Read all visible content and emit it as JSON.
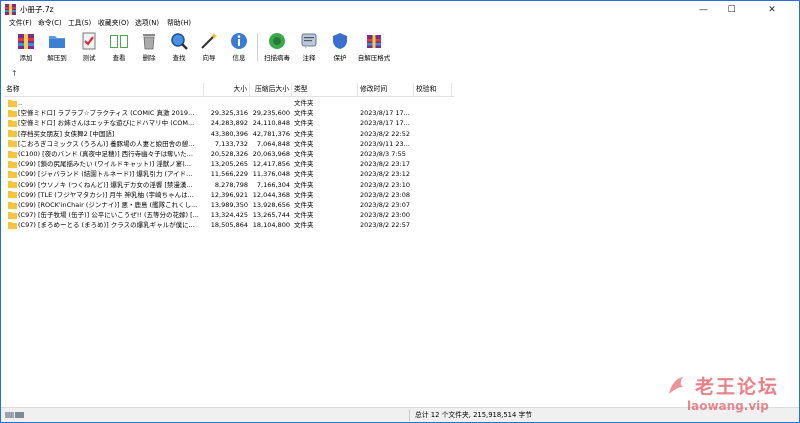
{
  "window": {
    "title": "小册子.7z"
  },
  "menu": [
    {
      "label": "文件(F)"
    },
    {
      "label": "命令(C)"
    },
    {
      "label": "工具(S)"
    },
    {
      "label": "收藏夹(O)"
    },
    {
      "label": "选项(N)"
    },
    {
      "label": "帮助(H)"
    }
  ],
  "toolbar": {
    "add": "添加",
    "extract_to": "解压到",
    "test": "测试",
    "view": "查看",
    "delete": "删除",
    "find": "查找",
    "wizard": "向导",
    "info": "信息",
    "virus_scan": "扫描病毒",
    "comment": "注释",
    "protect": "保护",
    "sfx": "自解压格式"
  },
  "nav": {
    "up_icon": "↑"
  },
  "columns": {
    "name": "名称",
    "size": "大小",
    "packed": "压缩后大小",
    "type": "类型",
    "modified": "修改时间",
    "crc": "校验和"
  },
  "rows": [
    {
      "name": "..",
      "size": "",
      "packed": "",
      "type": "文件夹",
      "modified": ""
    },
    {
      "name": "[空條ミドロ] ラブラブ☆プラクティス (COMIC 真激 2019...",
      "size": "29,325,316",
      "packed": "29,235,600",
      "type": "文件夹",
      "modified": "2023/8/17 17..."
    },
    {
      "name": "[空條ミドロ] お姉さんはエッチな遊びにドハマリ中 (COM...",
      "size": "24,283,892",
      "packed": "24,110,848",
      "type": "文件夹",
      "modified": "2023/8/17 17..."
    },
    {
      "name": "[存档买女朋友] 女侠舞2 [中国語]",
      "size": "43,380,396",
      "packed": "42,781,376",
      "type": "文件夹",
      "modified": "2023/8/2 22:52"
    },
    {
      "name": "[こおろぎコミックス (うろん)] 養豚場の人妻と娘田舎の憩...",
      "size": "7,133,732",
      "packed": "7,064,848",
      "type": "文件夹",
      "modified": "2023/9/11 23..."
    },
    {
      "name": "(C100) [夜のバンド (真夜中足穂)] 西行寺幽々子は奪いた...",
      "size": "20,528,326",
      "packed": "20,063,968",
      "type": "文件夹",
      "modified": "2023/8/3 7:55"
    },
    {
      "name": "(C99) [鎖の尻尾揺みたい (ワイルドキャット)] 淫獣ノ宴(...",
      "size": "13,205,265",
      "packed": "12,417,856",
      "type": "文件夹",
      "modified": "2023/8/2 23:17"
    },
    {
      "name": "(C99) [ジャバランド (結園トルネード)] 爆乳引力 (アイド...",
      "size": "11,566,229",
      "packed": "11,376,048",
      "type": "文件夹",
      "modified": "2023/8/2 23:12"
    },
    {
      "name": "(C99) [ウソノキ (つくねんど)] 爆乳デカ女の淫饗 [禁漫漢...",
      "size": "8,278,798",
      "packed": "7,166,304",
      "type": "文件夹",
      "modified": "2023/8/2 23:10"
    },
    {
      "name": "(C99) [TLE (フジヤマタカシ)] 月牛 神乳柚 (宇崎ちゃんは...",
      "size": "12,396,921",
      "packed": "12,044,368",
      "type": "文件夹",
      "modified": "2023/8/2 23:08"
    },
    {
      "name": "(C99) [ROCK'inChair (ジンナイ)] 悪・鹿島 (艦隊これくし...",
      "size": "13,989,350",
      "packed": "13,928,656",
      "type": "文件夹",
      "modified": "2023/8/2 23:07"
    },
    {
      "name": "(C97) [缶子牧場 (缶子)] 公平にいこうぜ!! (五等分の花嫁) [...",
      "size": "13,324,425",
      "packed": "13,265,744",
      "type": "文件夹",
      "modified": "2023/8/2 23:00"
    },
    {
      "name": "(C97) [まろめーとる (まろめ)] クラスの爆乳ギャルが僕に...",
      "size": "18,505,864",
      "packed": "18,104,800",
      "type": "文件夹",
      "modified": "2023/8/2 22:57"
    }
  ],
  "status": {
    "summary": "总计 12 个文件夹, 215,918,514 字节"
  },
  "watermark": {
    "cn": "老王论坛",
    "en": "laowang.vip"
  },
  "colors": {
    "accent": "#2a6fd6",
    "folder": "#f5c542",
    "watermark": "#dc3c46"
  }
}
